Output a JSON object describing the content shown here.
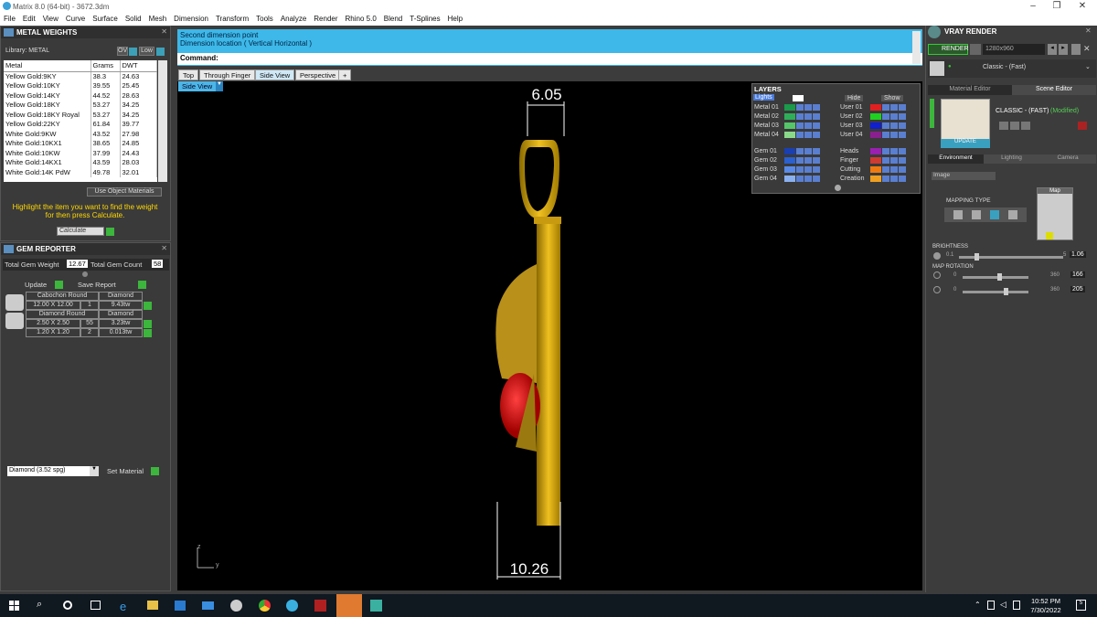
{
  "window": {
    "title": "Matrix 8.0 (64-bit) - 3672.3dm"
  },
  "menu": [
    "File",
    "Edit",
    "View",
    "Curve",
    "Surface",
    "Solid",
    "Mesh",
    "Dimension",
    "Transform",
    "Tools",
    "Analyze",
    "Render",
    "Rhino 5.0",
    "Blend",
    "T-Splines",
    "Help"
  ],
  "metal": {
    "title": "METAL WEIGHTS",
    "library_label": "Library: METAL",
    "btn_ov": "OV",
    "btn_low": "Low",
    "headers": [
      "Metal",
      "Grams",
      "DWT"
    ],
    "rows": [
      [
        "Yellow Gold:9KY",
        "38.3",
        "24.63"
      ],
      [
        "Yellow Gold:10KY",
        "39.55",
        "25.45"
      ],
      [
        "Yellow Gold:14KY",
        "44.52",
        "28.63"
      ],
      [
        "Yellow Gold:18KY",
        "53.27",
        "34.25"
      ],
      [
        "Yellow Gold:18KY Royal",
        "53.27",
        "34.25"
      ],
      [
        "Yellow Gold:22KY",
        "61.84",
        "39.77"
      ],
      [
        "White Gold:9KW",
        "43.52",
        "27.98"
      ],
      [
        "White Gold:10KX1",
        "38.65",
        "24.85"
      ],
      [
        "White Gold:10KW",
        "37.99",
        "24.43"
      ],
      [
        "White Gold:14KX1",
        "43.59",
        "28.03"
      ],
      [
        "White Gold:14K PdW",
        "49.78",
        "32.01"
      ]
    ],
    "use_object": "Use Object Materials",
    "hint": "Highlight the item you want to find the weight for then press Calculate.",
    "calculate": "Calculate"
  },
  "gem": {
    "title": "GEM REPORTER",
    "total_weight_label": "Total Gem Weight",
    "total_weight": "12.67",
    "total_count_label": "Total Gem Count",
    "total_count": "58",
    "update": "Update",
    "save": "Save Report",
    "groups": [
      {
        "name": "Cabochon Round",
        "type": "Diamond",
        "rows": [
          [
            "12.00 X 12.00",
            "1",
            "9.43tw"
          ]
        ]
      },
      {
        "name": "Diamond Round",
        "type": "Diamond",
        "rows": [
          [
            "2.50 X 2.50",
            "55",
            "3.23tw"
          ],
          [
            "1.20 X 1.20",
            "2",
            "0.013tw"
          ]
        ]
      }
    ],
    "material_select": "Diamond    (3.52 spg)",
    "set_material": "Set Material"
  },
  "command": {
    "line1": "Second dimension point",
    "line2": "Dimension location ( Vertical  Horizontal )",
    "label": "Command:"
  },
  "tabs": [
    "Top",
    "Through Finger",
    "Side View",
    "Perspective",
    "+"
  ],
  "viewport": {
    "label": "Side View",
    "dim_top": "6.05",
    "dim_bottom": "10.26",
    "axis_z": "z",
    "axis_y": "y"
  },
  "layers": {
    "title": "LAYERS",
    "lights": "Lights",
    "hide": "Hide",
    "show": "Show",
    "left": [
      {
        "name": "Metal 01",
        "color": "#1a9a4a"
      },
      {
        "name": "Metal 02",
        "color": "#2fae5a"
      },
      {
        "name": "Metal 03",
        "color": "#55c56a"
      },
      {
        "name": "Metal 04",
        "color": "#8ad98a"
      },
      {
        "name": "Gem 01",
        "color": "#1a3fb0"
      },
      {
        "name": "Gem 02",
        "color": "#2a60d0"
      },
      {
        "name": "Gem 03",
        "color": "#5a8ae8"
      },
      {
        "name": "Gem 04",
        "color": "#8ab0f0"
      }
    ],
    "right": [
      {
        "name": "User 01",
        "color": "#e02020"
      },
      {
        "name": "User 02",
        "color": "#20d020"
      },
      {
        "name": "User 03",
        "color": "#1020d0"
      },
      {
        "name": "User 04",
        "color": "#8a2090"
      },
      {
        "name": "Heads",
        "color": "#9a20b0"
      },
      {
        "name": "Finger",
        "color": "#d03a30"
      },
      {
        "name": "Cutting",
        "color": "#f07a10"
      },
      {
        "name": "Creation",
        "color": "#f0a020"
      }
    ]
  },
  "vray": {
    "title": "VRAY RENDER",
    "render": "RENDER",
    "resolution": "1280x960",
    "preset": "Classic - (Fast)",
    "tab_material": "Material Editor",
    "tab_scene": "Scene Editor",
    "scene_name": "CLASSIC - (FAST)",
    "scene_mod": "(Modified)",
    "update": "UPDATE",
    "tabs": [
      "Environment",
      "Lighting",
      "Camera"
    ],
    "image_select": "Image",
    "mapping_label": "MAPPING TYPE",
    "map_label": "Map",
    "brightness_label": "BRIGHTNESS",
    "brightness_min": "0.1",
    "brightness_max": "5",
    "brightness": "1.06",
    "rotation_label": "MAP ROTATION",
    "rot1_min": "0",
    "rot1_max": "360",
    "rot1": "166",
    "rot2_min": "0",
    "rot2_max": "360",
    "rot2": "205"
  },
  "taskbar": {
    "time": "10:52 PM",
    "date": "7/30/2022",
    "notif": "5"
  }
}
